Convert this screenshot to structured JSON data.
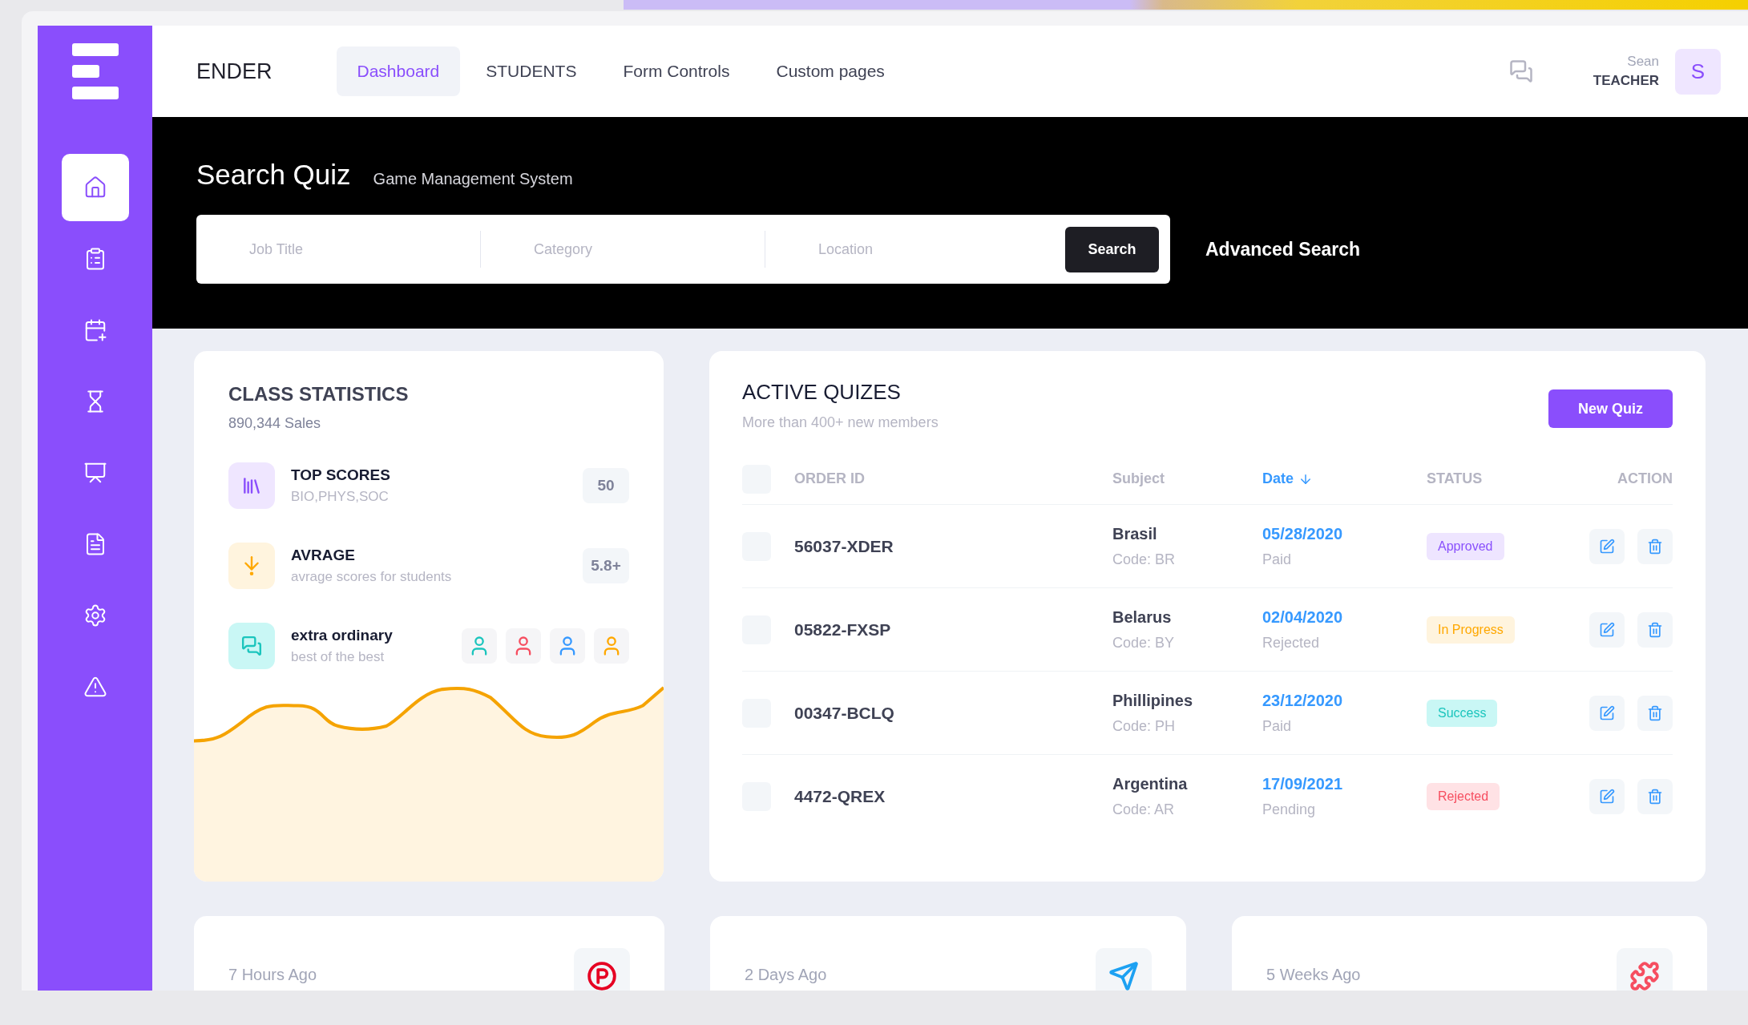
{
  "header": {
    "brand": "ENDER",
    "nav": [
      {
        "label": "Dashboard",
        "selected": true
      },
      {
        "label": "STUDENTS",
        "selected": false
      },
      {
        "label": "Form Controls",
        "selected": false
      },
      {
        "label": "Custom pages",
        "selected": false
      }
    ],
    "user": {
      "name": "Sean",
      "role": "TEACHER",
      "initial": "S"
    }
  },
  "sidebar": {
    "items": [
      {
        "kind": "home",
        "selected": true
      },
      {
        "kind": "clipboard",
        "selected": false
      },
      {
        "kind": "calendar",
        "selected": false
      },
      {
        "kind": "hourglass",
        "selected": false
      },
      {
        "kind": "presentation",
        "selected": false
      },
      {
        "kind": "file",
        "selected": false
      },
      {
        "kind": "settings",
        "selected": false
      },
      {
        "kind": "alert",
        "selected": false
      }
    ]
  },
  "banner": {
    "title": "Search Quiz",
    "subtitle": "Game Management System",
    "fields": [
      {
        "placeholder": "Job Title"
      },
      {
        "placeholder": "Category"
      },
      {
        "placeholder": "Location"
      }
    ],
    "search_button": "Search",
    "advanced_link": "Advanced Search"
  },
  "class_statistics": {
    "title": "CLASS STATISTICS",
    "subtitle": "890,344 Sales",
    "items": [
      {
        "kind": "scores",
        "title": "TOP SCORES",
        "subtitle": "BIO,PHYS,SOC",
        "value": "50"
      },
      {
        "kind": "average",
        "title": "AVRAGE",
        "subtitle": "avrage scores for students",
        "value": "5.8+"
      },
      {
        "kind": "team",
        "title": "extra ordinary",
        "subtitle": "best of the best"
      }
    ]
  },
  "active_quizzes": {
    "title": "ACTIVE QUIZES",
    "subtitle": "More than 400+ new members",
    "new_button": "New Quiz",
    "select_all_checked": false,
    "columns": [
      {
        "label": "ORDER ID",
        "sorted": false
      },
      {
        "label": "Subject",
        "sorted": false
      },
      {
        "label": "Date",
        "sorted": true
      },
      {
        "label": "STATUS",
        "sorted": false
      },
      {
        "label": "ACTION",
        "sorted": false
      }
    ],
    "rows": [
      {
        "checked": false,
        "order_id": "56037-XDER",
        "subject": "Brasil",
        "code": "Code: BR",
        "date": "05/28/2020",
        "payment": "Paid",
        "status": "Approved",
        "kind": "approved"
      },
      {
        "checked": false,
        "order_id": "05822-FXSP",
        "subject": "Belarus",
        "code": "Code: BY",
        "date": "02/04/2020",
        "payment": "Rejected",
        "status": "In Progress",
        "kind": "progress"
      },
      {
        "checked": false,
        "order_id": "00347-BCLQ",
        "subject": "Phillipines",
        "code": "Code: PH",
        "date": "23/12/2020",
        "payment": "Paid",
        "status": "Success",
        "kind": "success"
      },
      {
        "checked": false,
        "order_id": "4472-QREX",
        "subject": "Argentina",
        "code": "Code: AR",
        "date": "17/09/2021",
        "payment": "Pending",
        "status": "Rejected",
        "kind": "rejected"
      }
    ]
  },
  "activity_cards": [
    {
      "time": "7 Hours Ago",
      "kind": "p-logo"
    },
    {
      "time": "2 Days Ago",
      "kind": "plane"
    },
    {
      "time": "5 Weeks Ago",
      "kind": "puzzle"
    }
  ]
}
